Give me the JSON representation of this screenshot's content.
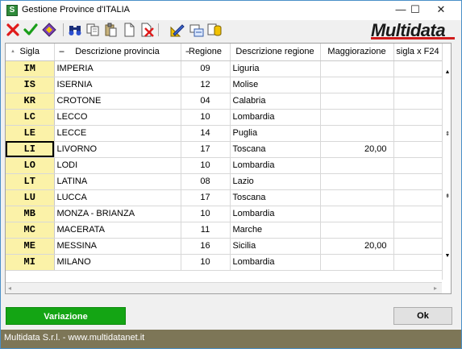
{
  "window": {
    "title": "Gestione Province d'ITALIA",
    "app_icon_letter": "S",
    "controls": {
      "minimize": "—",
      "maximize": "☐",
      "close": "✕"
    }
  },
  "toolbar": {
    "buttons": [
      {
        "name": "delete-button",
        "icon": "red-x-icon"
      },
      {
        "name": "confirm-button",
        "icon": "green-check-icon"
      },
      {
        "name": "erase-button",
        "icon": "eraser-icon"
      },
      {
        "name": "search-button",
        "icon": "binoculars-icon"
      },
      {
        "name": "copy-button",
        "icon": "copy-icon"
      },
      {
        "name": "paste-button",
        "icon": "paste-icon"
      },
      {
        "name": "new-document-button",
        "icon": "document-icon"
      },
      {
        "name": "delete-document-button",
        "icon": "document-delete-icon"
      },
      {
        "name": "edit-button",
        "icon": "pencil-ruler-icon"
      },
      {
        "name": "export-button",
        "icon": "export-icon"
      },
      {
        "name": "database-button",
        "icon": "database-icon"
      }
    ],
    "logo_text": "Multidata",
    "colors": {
      "logo_accent": "#d11c1c"
    }
  },
  "grid": {
    "columns": [
      "Sigla",
      "Descrizione provincia",
      "Regione",
      "Descrizione regione",
      "Maggiorazione",
      "sigla x F24"
    ],
    "rows": [
      {
        "sigla": "IM",
        "provincia": "IMPERIA",
        "regione": "09",
        "descrizione_regione": "Liguria",
        "maggiorazione": "",
        "sigla_f24": ""
      },
      {
        "sigla": "IS",
        "provincia": "ISERNIA",
        "regione": "12",
        "descrizione_regione": "Molise",
        "maggiorazione": "",
        "sigla_f24": ""
      },
      {
        "sigla": "KR",
        "provincia": "CROTONE",
        "regione": "04",
        "descrizione_regione": "Calabria",
        "maggiorazione": "",
        "sigla_f24": ""
      },
      {
        "sigla": "LC",
        "provincia": "LECCO",
        "regione": "10",
        "descrizione_regione": "Lombardia",
        "maggiorazione": "",
        "sigla_f24": ""
      },
      {
        "sigla": "LE",
        "provincia": "LECCE",
        "regione": "14",
        "descrizione_regione": "Puglia",
        "maggiorazione": "",
        "sigla_f24": ""
      },
      {
        "sigla": "LI",
        "provincia": "LIVORNO",
        "regione": "17",
        "descrizione_regione": "Toscana",
        "maggiorazione": "20,00",
        "sigla_f24": ""
      },
      {
        "sigla": "LO",
        "provincia": "LODI",
        "regione": "10",
        "descrizione_regione": "Lombardia",
        "maggiorazione": "",
        "sigla_f24": ""
      },
      {
        "sigla": "LT",
        "provincia": "LATINA",
        "regione": "08",
        "descrizione_regione": "Lazio",
        "maggiorazione": "",
        "sigla_f24": ""
      },
      {
        "sigla": "LU",
        "provincia": "LUCCA",
        "regione": "17",
        "descrizione_regione": "Toscana",
        "maggiorazione": "",
        "sigla_f24": ""
      },
      {
        "sigla": "MB",
        "provincia": "MONZA - BRIANZA",
        "regione": "10",
        "descrizione_regione": "Lombardia",
        "maggiorazione": "",
        "sigla_f24": ""
      },
      {
        "sigla": "MC",
        "provincia": "MACERATA",
        "regione": "11",
        "descrizione_regione": "Marche",
        "maggiorazione": "",
        "sigla_f24": ""
      },
      {
        "sigla": "ME",
        "provincia": "MESSINA",
        "regione": "16",
        "descrizione_regione": "Sicilia",
        "maggiorazione": "20,00",
        "sigla_f24": ""
      },
      {
        "sigla": "MI",
        "provincia": "MILANO",
        "regione": "10",
        "descrizione_regione": "Lombardia",
        "maggiorazione": "",
        "sigla_f24": ""
      }
    ],
    "selected_row": 5,
    "colors": {
      "sigla_background": "#fbf2a8"
    }
  },
  "buttons": {
    "variazione": "Variazione",
    "ok": "Ok",
    "colors": {
      "variazione_background": "#14a514"
    }
  },
  "footer": {
    "text": "Multidata S.r.l. - www.multidatanet.it",
    "colors": {
      "background": "#7d7657"
    }
  }
}
